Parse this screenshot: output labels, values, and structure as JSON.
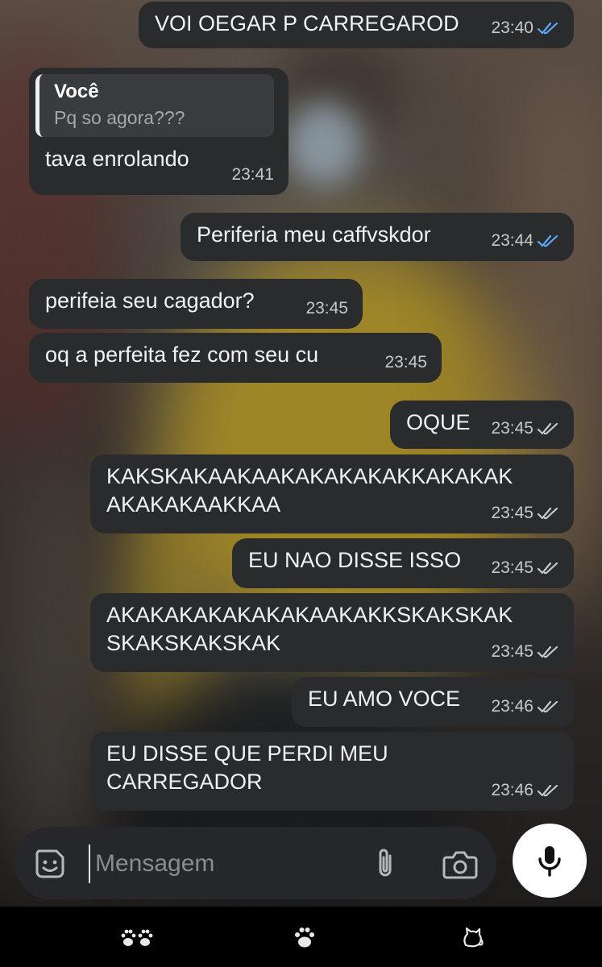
{
  "conversation": {
    "messages": [
      {
        "side": "out",
        "text": "VOI OEGAR P CARREGAROD",
        "time": "23:40",
        "status": "read"
      },
      {
        "side": "in",
        "reply_to": {
          "name": "Você",
          "text": "Pq so agora???"
        },
        "text": "tava enrolando",
        "time": "23:41"
      },
      {
        "side": "out",
        "text": "Periferia meu caffvskdor",
        "time": "23:44",
        "status": "read"
      },
      {
        "side": "in",
        "text": "perifeia seu cagador?",
        "time": "23:45"
      },
      {
        "side": "in",
        "text": "oq a perfeita fez com seu cu",
        "time": "23:45"
      },
      {
        "side": "out",
        "text": "OQUE",
        "time": "23:45",
        "status": "delivered"
      },
      {
        "side": "out",
        "lines": [
          "KAKSKAKAAKAAKAKAKAKAKKAKAKAK",
          "AKAKAKAAKKAA"
        ],
        "time": "23:45",
        "status": "delivered"
      },
      {
        "side": "out",
        "text": "EU NAO DISSE ISSO",
        "time": "23:45",
        "status": "delivered"
      },
      {
        "side": "out",
        "lines": [
          "AKAKAKAKAKAKAKAAKAKKSKAKSKAK",
          "SKAKSKAKSKAK"
        ],
        "time": "23:45",
        "status": "delivered"
      },
      {
        "side": "out",
        "text": "EU AMO VOCE",
        "time": "23:46",
        "status": "delivered"
      },
      {
        "side": "out",
        "lines": [
          "EU DISSE QUE PERDI MEU",
          "CARREGADOR"
        ],
        "time": "23:46",
        "status": "delivered"
      }
    ]
  },
  "composer": {
    "placeholder": "Mensagem",
    "sticker_icon": "sticker-icon",
    "attach_icon": "paperclip-icon",
    "camera_icon": "camera-icon",
    "mic_icon": "microphone-icon"
  },
  "nav": {
    "icons": [
      "paw-prints-icon",
      "paw-icon",
      "cat-icon"
    ]
  },
  "colors": {
    "bubble": "#2a2b2d",
    "read_ticks": "#5ea8ff",
    "delivered_ticks": "#c9c9c9",
    "mic_button": "#ffffff"
  }
}
